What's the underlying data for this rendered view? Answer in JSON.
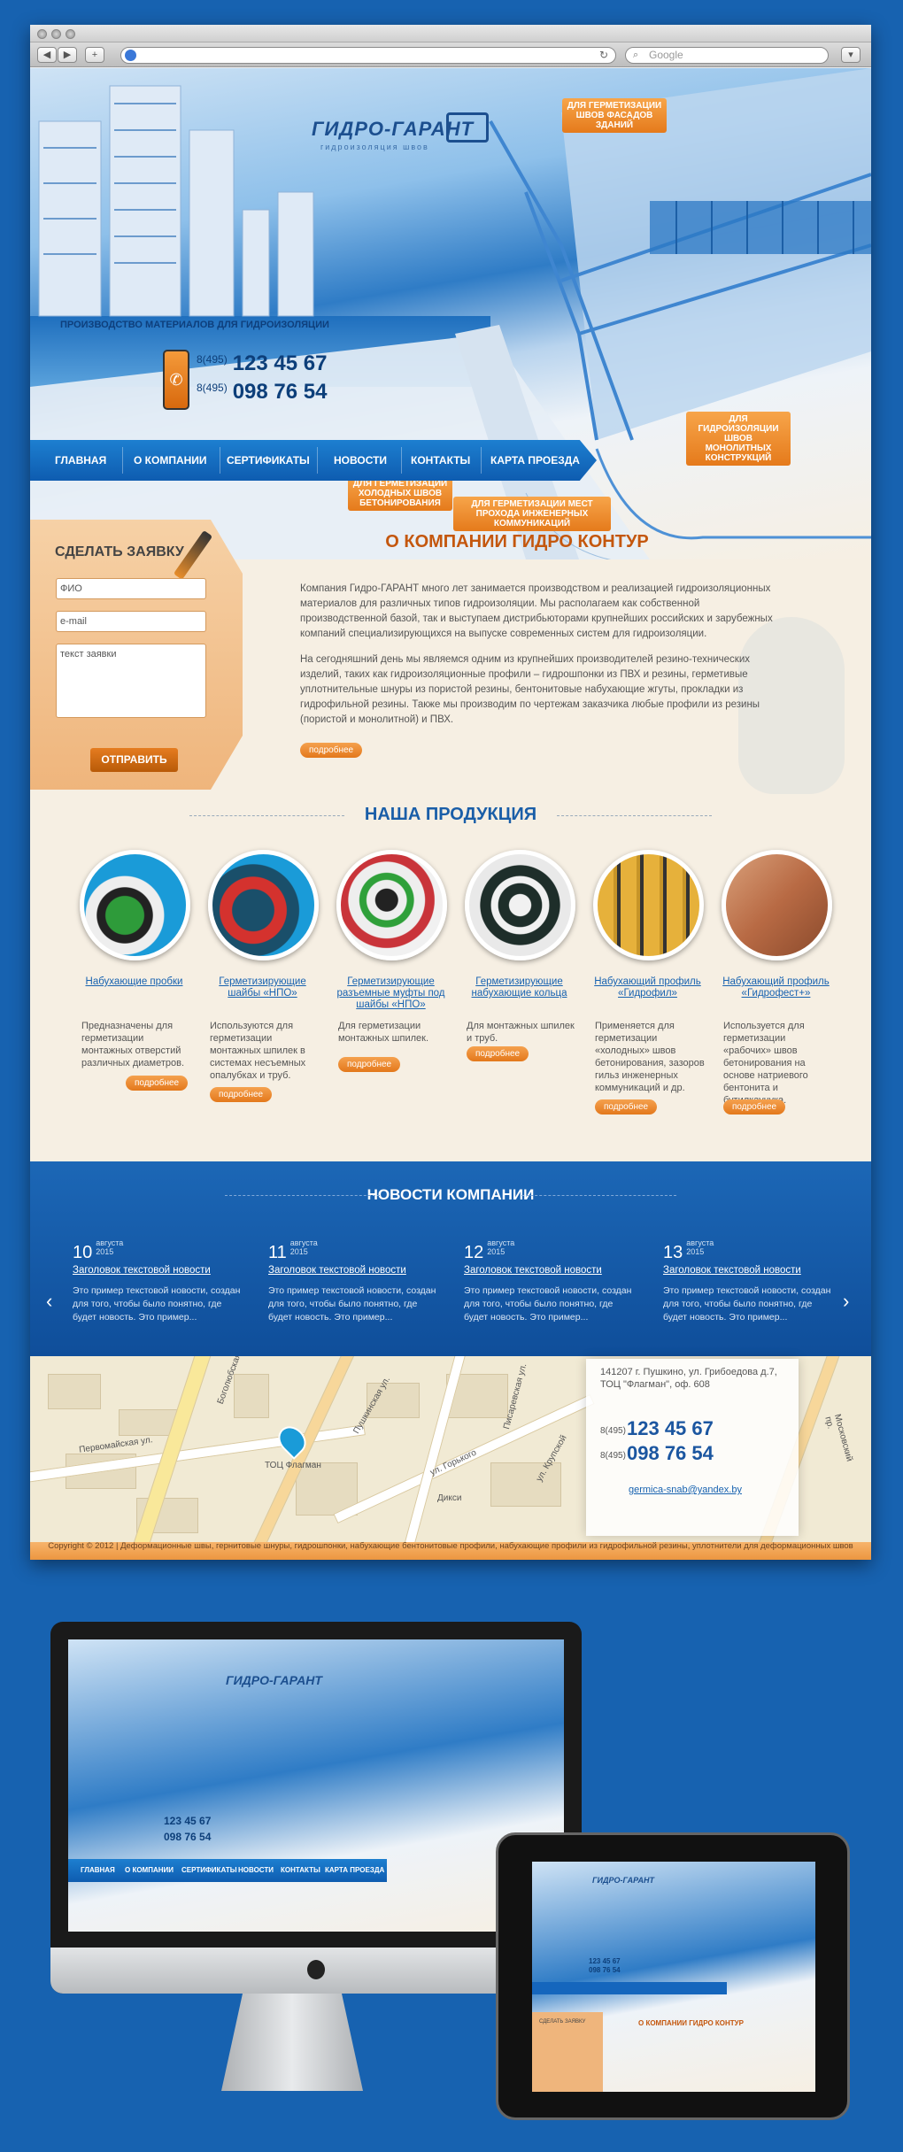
{
  "browser": {
    "back": "◀",
    "fwd": "▶",
    "add": "+",
    "search_placeholder": "Google"
  },
  "hero": {
    "logo_name": "ГИДРО-ГАРАНТ",
    "logo_tagline": "гидроизоляция швов",
    "production": "ПРОИЗВОДСТВО МАТЕРИАЛОВ ДЛЯ ГИДРОИЗОЛЯЦИИ",
    "phones": [
      {
        "code": "8(495)",
        "number": "123 45 67"
      },
      {
        "code": "8(495)",
        "number": "098 76 54"
      }
    ],
    "tags": [
      "ДЛЯ ГЕРМЕТИЗАЦИИ ШВОВ ФАСАДОВ ЗДАНИЙ",
      "ДЛЯ ГИДРОИЗОЛЯЦИИ ШВОВ МОНОЛИТНЫХ КОНСТРУКЦИЙ",
      "ДЛЯ ГЕРМЕТИЗАЦИИ ХОЛОДНЫХ ШВОВ БЕТОНИРОВАНИЯ",
      "ДЛЯ ГЕРМЕТИЗАЦИИ МЕСТ ПРОХОДА ИНЖЕНЕРНЫХ КОММУНИКАЦИЙ"
    ]
  },
  "nav": [
    "ГЛАВНАЯ",
    "О КОМПАНИИ",
    "СЕРТИФИКАТЫ",
    "НОВОСТИ",
    "КОНТАКТЫ",
    "КАРТА ПРОЕЗДА"
  ],
  "order": {
    "title": "СДЕЛАТЬ ЗАЯВКУ",
    "fio": "ФИО",
    "email": "e-mail",
    "text": "текст заявки",
    "submit": "ОТПРАВИТЬ"
  },
  "about": {
    "title": "О КОМПАНИИ ГИДРО КОНТУР",
    "p1": "Компания Гидро-ГАРАНТ много лет занимается производством и реализацией гидроизоляционных материалов для различных типов гидроизоляции. Мы располагаем как собственной производственной базой, так и выступаем дистрибьюторами крупнейших российских и зарубежных компаний специализирующихся на выпуске современных систем для гидроизоляции.",
    "p2": "На сегодняшний день мы являемся одним из крупнейших производителей резино-технических изделий, таких как гидроизоляционные профили – гидрошпонки из ПВХ и резины, герметивые уплотнительные шнуры из пористой резины, бентонитовые набухающие  жгуты, прокладки из гидрофильной резины. Также мы производим по чертежам заказчика любые профили из резины (пористой и монолитной) и ПВХ.",
    "more": "подробнее"
  },
  "products": {
    "title": "НАША ПРОДУКЦИЯ",
    "items": [
      {
        "name": "Набухающие пробки",
        "desc": "Предназначены для герметизации монтажных отверстий различных диаметров.",
        "more": "подробнее",
        "color": "#2e9b3a"
      },
      {
        "name": "Герметизирующие шайбы «НПО»",
        "desc": "Используются для герметизации монтажных шпилек в системах несъемных опалубках и труб.",
        "more": "подробнее",
        "color": "#1a4f6a"
      },
      {
        "name": "Герметизирующие разъемные муфты под шайбы «НПО»",
        "desc": "Для герметизации монтажных шпилек.",
        "more": "подробнее",
        "color": "#c9343a"
      },
      {
        "name": "Герметизирующие набухающие кольца",
        "desc": "Для монтажных шпилек и труб.",
        "more": "подробнее",
        "color": "#1e2e2a"
      },
      {
        "name": "Набухающий профиль «Гидрофил»",
        "desc": "Применяется для герметизации «холодных» швов бетонирования, зазоров гильз инженерных коммуникаций и др.",
        "more": "подробнее",
        "color": "#e6b13b"
      },
      {
        "name": "Набухающий профиль «Гидрофест+»",
        "desc": "Используется для герметизации «рабочих» швов бетонирования на основе натриевого бентонита и бутилкаучука.",
        "more": "подробнее",
        "color": "#b86a44"
      }
    ]
  },
  "news": {
    "title": "НОВОСТИ КОМПАНИИ",
    "items": [
      {
        "day": "10",
        "month": "августа",
        "year": "2015",
        "title": "Заголовок текстовой новости",
        "text": "Это пример текстовой новости, создан для того, чтобы было понятно, где будет новость. Это пример..."
      },
      {
        "day": "11",
        "month": "августа",
        "year": "2015",
        "title": "Заголовок текстовой новости",
        "text": "Это пример текстовой новости, создан для того, чтобы было понятно, где будет новость. Это пример..."
      },
      {
        "day": "12",
        "month": "августа",
        "year": "2015",
        "title": "Заголовок текстовой новости",
        "text": "Это пример текстовой новости, создан для того, чтобы было понятно, где будет новость. Это пример..."
      },
      {
        "day": "13",
        "month": "августа",
        "year": "2015",
        "title": "Заголовок текстовой новости",
        "text": "Это пример текстовой новости, создан для того, чтобы было понятно, где будет новость. Это пример..."
      }
    ]
  },
  "map": {
    "labels": [
      "Первомайская ул.",
      "Боголюбская",
      "Писаревская ул.",
      "ул. Крупской",
      "ул. Горького",
      "Пушкинская ул.",
      "Дикси",
      "ТОЦ Флагман",
      "Московский пр."
    ]
  },
  "contact": {
    "address": "141207 г. Пушкино, ул. Грибоедова д.7, ТОЦ \"Флагман\", оф. 608",
    "phones": [
      {
        "code": "8(495)",
        "number": "123 45 67"
      },
      {
        "code": "8(495)",
        "number": "098 76 54"
      }
    ],
    "email": "germica-snab@yandex.by"
  },
  "footer": "Copyright © 2012 | Деформационные швы, гернитовые шнуры, гидрошпонки, набухающие бентонитовые профили, набухающие профили из гидрофильной резины, уплотнители для деформационных швов",
  "mockup": {
    "logo": "ГИДРО-ГАРАНТ",
    "phone1": "123 45 67",
    "phone2": "098 76 54",
    "nav": [
      "ГЛАВНАЯ",
      "О КОМПАНИИ",
      "СЕРТИФИКАТЫ",
      "НОВОСТИ",
      "КОНТАКТЫ",
      "КАРТА ПРОЕЗДА"
    ],
    "about": "О КОМПАНИИ ГИДРО КОНТУР",
    "order": "СДЕЛАТЬ ЗАЯВКУ"
  }
}
